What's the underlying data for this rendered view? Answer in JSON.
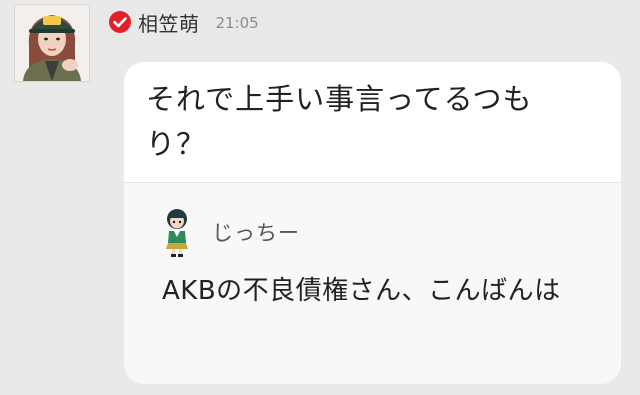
{
  "post": {
    "author_name": "相笠萌",
    "time": "21:05",
    "message": "それで上手い事言ってるつもり？",
    "verified_icon": "verified-check-icon",
    "avatar": "author-avatar"
  },
  "quoted": {
    "author_name": "じっちー",
    "message": "AKBの不良債権さん、こんばんは",
    "avatar": "quoted-author-avatar"
  },
  "colors": {
    "background": "#e9e9e9",
    "bubble": "#ffffff",
    "verified": "#e0202a"
  }
}
